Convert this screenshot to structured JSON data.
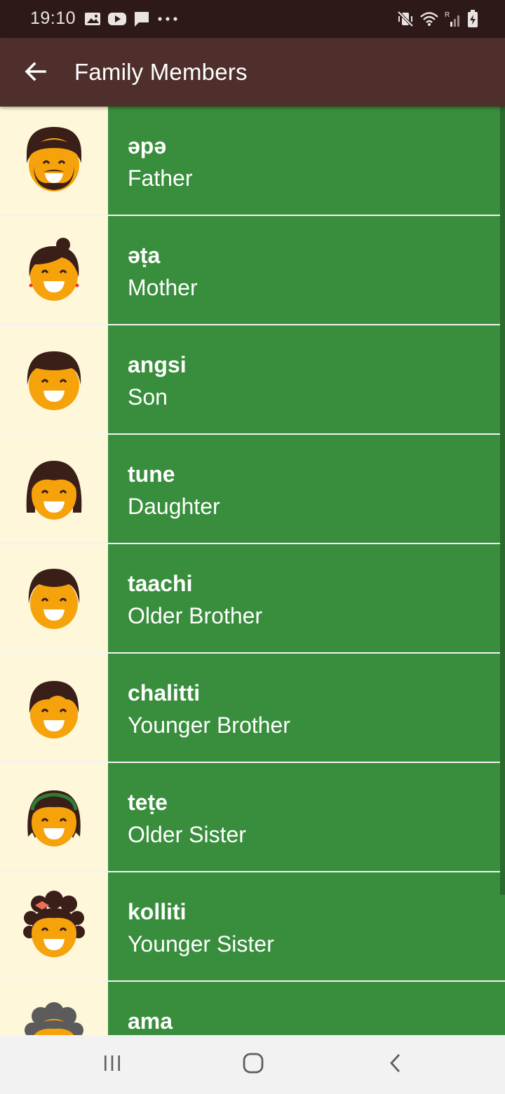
{
  "status_bar": {
    "time": "19:10",
    "left_icons": [
      "gallery-icon",
      "youtube-icon",
      "message-icon",
      "more-dots-icon"
    ],
    "right_icons": [
      "mute-vibrate-icon",
      "wifi-icon",
      "signal-roaming-icon",
      "battery-charging-icon"
    ]
  },
  "app_bar": {
    "title": "Family Members",
    "back_icon": "arrow-left-icon",
    "background": "#4e2f2b"
  },
  "colors": {
    "status_bar": "#2d1a18",
    "avatar_background": "#fff7da",
    "item_background": "#388e3c",
    "skin": "#f6a20a",
    "hair": "#3a1e18"
  },
  "members": [
    {
      "word": "əpə",
      "meaning": "Father",
      "avatar": "man-with-beard-avatar"
    },
    {
      "word": "əṭa",
      "meaning": "Mother",
      "avatar": "woman-with-earrings-avatar"
    },
    {
      "word": "angsi",
      "meaning": "Son",
      "avatar": "boy-avatar"
    },
    {
      "word": "tune",
      "meaning": "Daughter",
      "avatar": "girl-avatar"
    },
    {
      "word": "taachi",
      "meaning": "Older Brother",
      "avatar": "older-boy-avatar"
    },
    {
      "word": "chalitti",
      "meaning": "Younger Brother",
      "avatar": "young-boy-avatar"
    },
    {
      "word": "teṭe",
      "meaning": "Older Sister",
      "avatar": "girl-with-headband-avatar"
    },
    {
      "word": "kolliti",
      "meaning": "Younger Sister",
      "avatar": "girl-with-bow-avatar"
    },
    {
      "word": "ama",
      "meaning": "",
      "avatar": "grandmother-avatar"
    }
  ],
  "nav_bar": {
    "buttons": [
      "recent-apps-icon",
      "home-icon",
      "back-icon"
    ]
  }
}
